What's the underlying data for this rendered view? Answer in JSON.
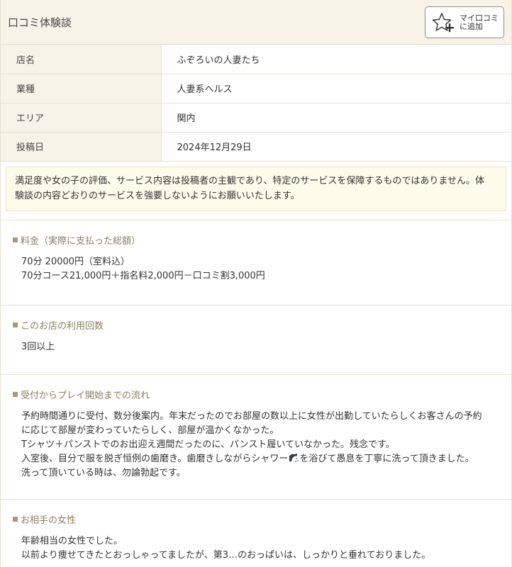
{
  "header": {
    "title": "口コミ体験談",
    "mylist_line1": "マイ口コミ",
    "mylist_line2": "に追加",
    "icon": "star-plus-icon"
  },
  "info": {
    "rows": [
      {
        "key": "店名",
        "value": "ふぞろいの人妻たち"
      },
      {
        "key": "業種",
        "value": "人妻系ヘルス"
      },
      {
        "key": "エリア",
        "value": "関内"
      },
      {
        "key": "投稿日",
        "value": "2024年12月29日"
      }
    ]
  },
  "notice": {
    "line1": "満足度や女の子の評価、サービス内容は投稿者の主観であり、特定のサービスを保障するものではありません。体",
    "line2": "験談の内容どおりのサービスを強要しないようにお願いいたします。"
  },
  "sections": {
    "price": {
      "heading": "料金（実際に支払った総額）",
      "lines": [
        "70分 20000円（室料込）",
        "70分コース21,000円＋指名料2,000円－口コミ割3,000円"
      ]
    },
    "visits": {
      "heading": "このお店の利用回数",
      "lines": [
        "3回以上"
      ]
    },
    "flow": {
      "heading": "受付からプレイ開始までの流れ",
      "lines": [
        "予約時間通りに受付、数分後案内。年末だったのでお部屋の数以上に女性が出勤していたらしくお客さんの予約",
        "に応じて部屋が変わっていたらしく、部屋が温かくなかった。",
        "Tシャツ＋パンストでのお出迎え週間だったのに、パンスト履いていなかった。残念です。"
      ],
      "line4_before": "入室後、目分で服を脱ぎ恒例の歯磨き。歯磨きしながらシャワー",
      "line4_after": "を浴びて愚息を丁寧に洗って頂きました。",
      "line5": "洗って頂いている時は、勿論勃起です。",
      "emoji_icon": "shower-icon"
    },
    "partner": {
      "heading": "お相手の女性",
      "lines": [
        "年齢相当の女性でした。",
        "以前より痩せてきたとおっしゃってましたが、第3…のおっぱいは、しっかりと垂れておりました。"
      ]
    }
  },
  "colors": {
    "header_bg": "#f7f3e8",
    "heading_text": "#8b7f62",
    "notice_bg": "#fdfbea"
  }
}
